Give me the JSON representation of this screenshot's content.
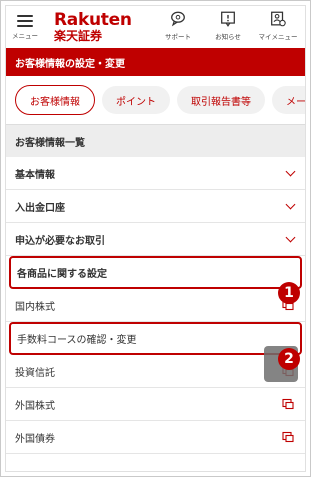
{
  "header": {
    "menu_label": "メニュー",
    "logo_en": "Rakuten",
    "logo_jp": "楽天証券",
    "support": "サポート",
    "news": "お知らせ",
    "mymenu": "マイメニュー"
  },
  "title_bar": "お客様情報の設定・変更",
  "tabs": [
    "お客様情報",
    "ポイント",
    "取引報告書等",
    "メール等"
  ],
  "section_title": "お客様情報一覧",
  "collapsible": [
    "基本情報",
    "入出金口座",
    "申込が必要なお取引"
  ],
  "highlight_header": "各商品に関する設定",
  "rows": [
    "国内株式",
    "手数料コースの確認・変更",
    "投資信託",
    "外国株式",
    "外国債券"
  ],
  "badges": [
    "1",
    "2"
  ],
  "colors": {
    "brand": "#bf0000"
  }
}
